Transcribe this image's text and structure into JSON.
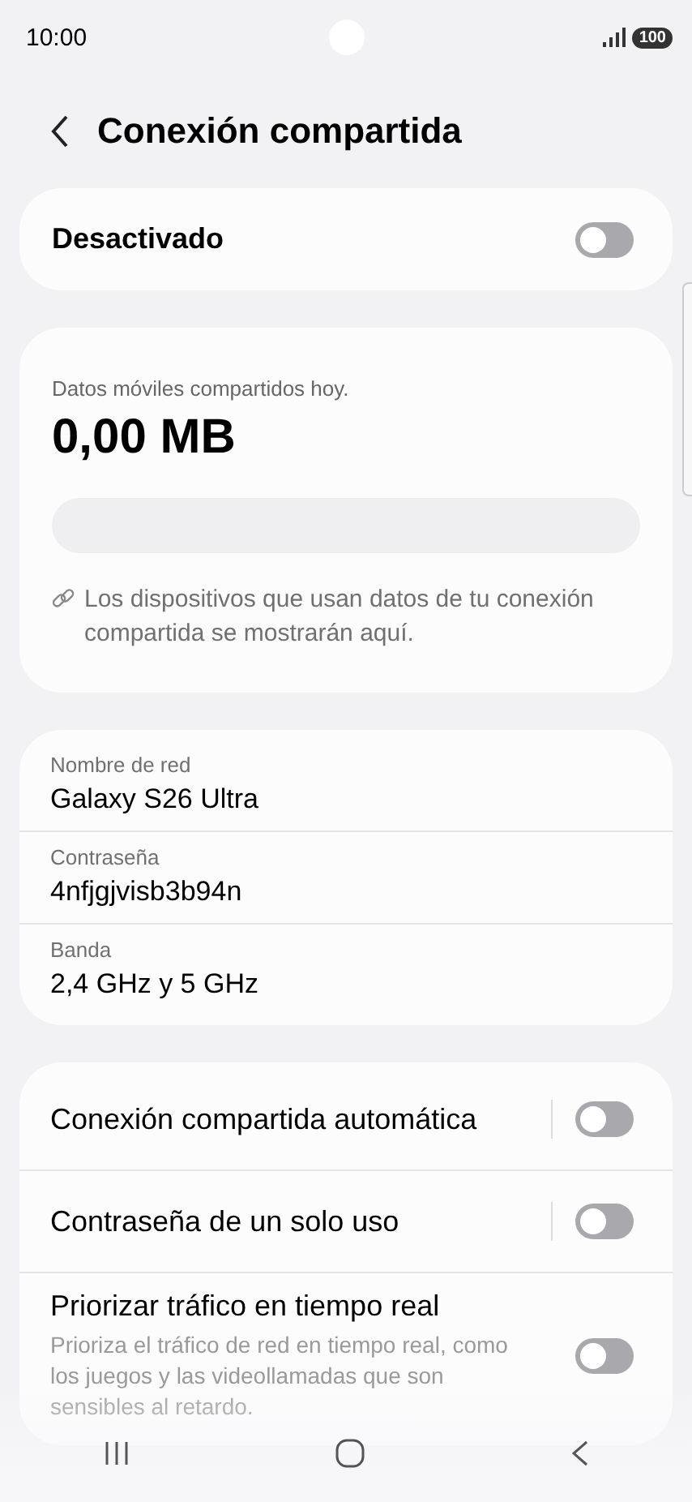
{
  "status_bar": {
    "time": "10:00",
    "battery": "100"
  },
  "header": {
    "title": "Conexión compartida"
  },
  "master": {
    "label": "Desactivado",
    "on": false
  },
  "usage": {
    "caption": "Datos móviles compartidos hoy.",
    "amount": "0,00 MB",
    "level": 0,
    "note": "Los dispositivos que usan datos de tu conexión compartida se mostrarán aquí."
  },
  "network": [
    {
      "label": "Nombre de red",
      "value": "Galaxy S26 Ultra"
    },
    {
      "label": "Contraseña",
      "value": "4nfjgjvisb3b94n"
    },
    {
      "label": "Banda",
      "value": "2,4 GHz y 5 GHz"
    }
  ],
  "settings": [
    {
      "title": "Conexión compartida automática",
      "split": true,
      "on": false
    },
    {
      "title": "Contraseña de un solo uso",
      "split": true,
      "on": false
    },
    {
      "title": "Priorizar tráfico en tiempo real",
      "description": "Prioriza el tráfico de red en tiempo real, como los juegos y las videollamadas que son sensibles al retardo.",
      "split": false,
      "on": false
    }
  ]
}
